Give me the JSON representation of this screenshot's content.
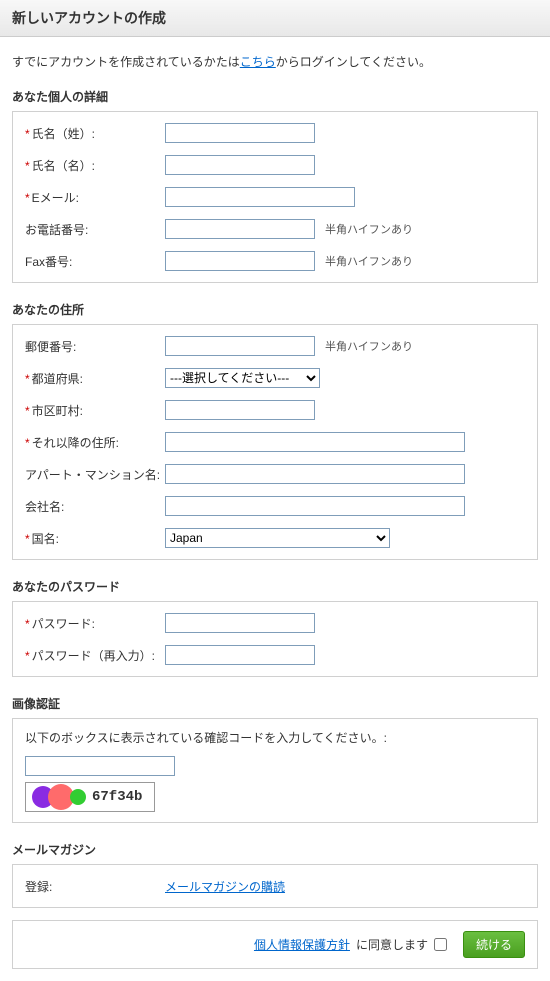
{
  "page_title": "新しいアカウントの作成",
  "intro_prefix": "すでにアカウントを作成されているかたは",
  "intro_link": "こちら",
  "intro_suffix": "からログインしてください。",
  "sections": {
    "personal": {
      "header": "あなた個人の詳細",
      "fields": {
        "lastname_label": "氏名（姓）:",
        "firstname_label": "氏名（名）:",
        "email_label": "Eメール:",
        "phone_label": "お電話番号:",
        "phone_hint": "半角ハイフンあり",
        "fax_label": "Fax番号:",
        "fax_hint": "半角ハイフンあり"
      }
    },
    "address": {
      "header": "あなたの住所",
      "fields": {
        "postal_label": "郵便番号:",
        "postal_hint": "半角ハイフンあり",
        "pref_label": "都道府県:",
        "pref_placeholder": "---選択してください---",
        "city_label": "市区町村:",
        "street_label": "それ以降の住所:",
        "apt_label": "アパート・マンション名:",
        "company_label": "会社名:",
        "country_label": "国名:",
        "country_value": "Japan"
      }
    },
    "password": {
      "header": "あなたのパスワード",
      "fields": {
        "pw_label": "パスワード:",
        "pw_confirm_label": "パスワード（再入力）:"
      }
    },
    "captcha": {
      "header": "画像認証",
      "instruction": "以下のボックスに表示されている確認コードを入力してください。:",
      "code": "67f34b"
    },
    "newsletter": {
      "header": "メールマガジン",
      "register_label": "登録:",
      "link_text": "メールマガジンの購読"
    }
  },
  "footer": {
    "privacy_link": "個人情報保護方針",
    "agree_text": "に同意します",
    "continue_btn": "続ける"
  }
}
